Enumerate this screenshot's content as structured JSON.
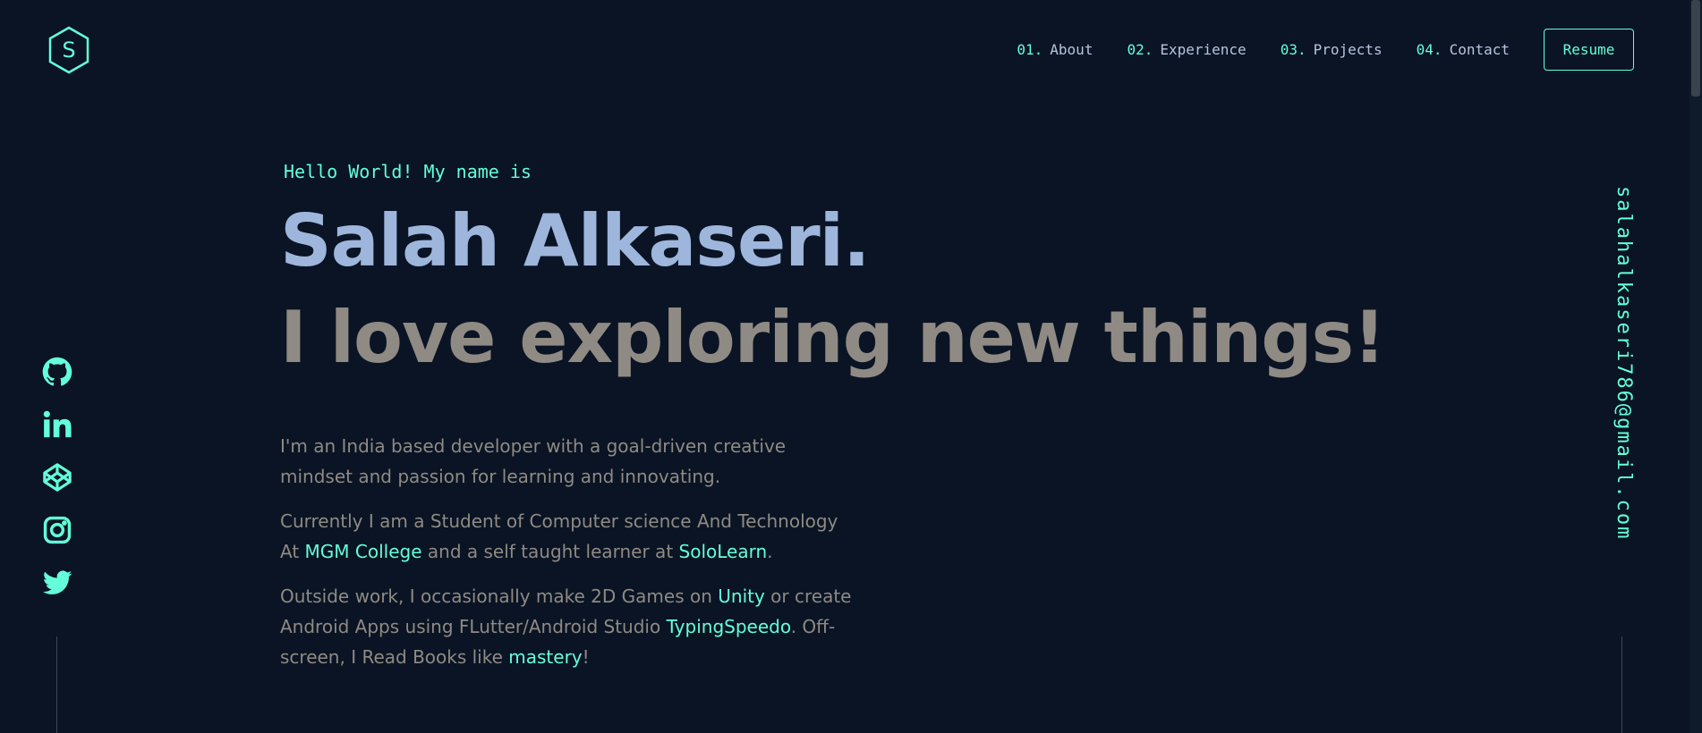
{
  "logo": {
    "letter": "S",
    "icon": "hexagon-logo-icon"
  },
  "nav": {
    "links": [
      {
        "num": "01.",
        "label": "About"
      },
      {
        "num": "02.",
        "label": "Experience"
      },
      {
        "num": "03.",
        "label": "Projects"
      },
      {
        "num": "04.",
        "label": "Contact"
      }
    ],
    "resume_label": "Resume"
  },
  "social": {
    "icons": [
      "github-icon",
      "linkedin-icon",
      "codepen-icon",
      "instagram-icon",
      "twitter-icon"
    ]
  },
  "email": "salahalkaseri786@gmail.com",
  "hero": {
    "greeting": "Hello World! My name is",
    "name": "Salah Alkaseri.",
    "tagline": "I love exploring new things!"
  },
  "bio": {
    "p1": "I'm an India based developer with a goal-driven creative mindset and passion for learning and innovating.",
    "p2_a": "Currently I am a Student of Computer science And Technology At ",
    "p2_link1": "MGM College",
    "p2_b": " and a self taught learner at ",
    "p2_link2": "SoloLearn",
    "p2_c": ".",
    "p3_a": "Outside work, I occasionally make 2D Games on ",
    "p3_link1": "Unity",
    "p3_b": " or create Android Apps using FLutter/Android Studio ",
    "p3_link2": "TypingSpeedo",
    "p3_c": ". Off-screen, I Read Books like ",
    "p3_link3": "mastery",
    "p3_d": "!"
  },
  "colors": {
    "background": "#0a1424",
    "accent": "#64ffda",
    "name": "#9eb6dc",
    "text": "#8f8a83"
  }
}
